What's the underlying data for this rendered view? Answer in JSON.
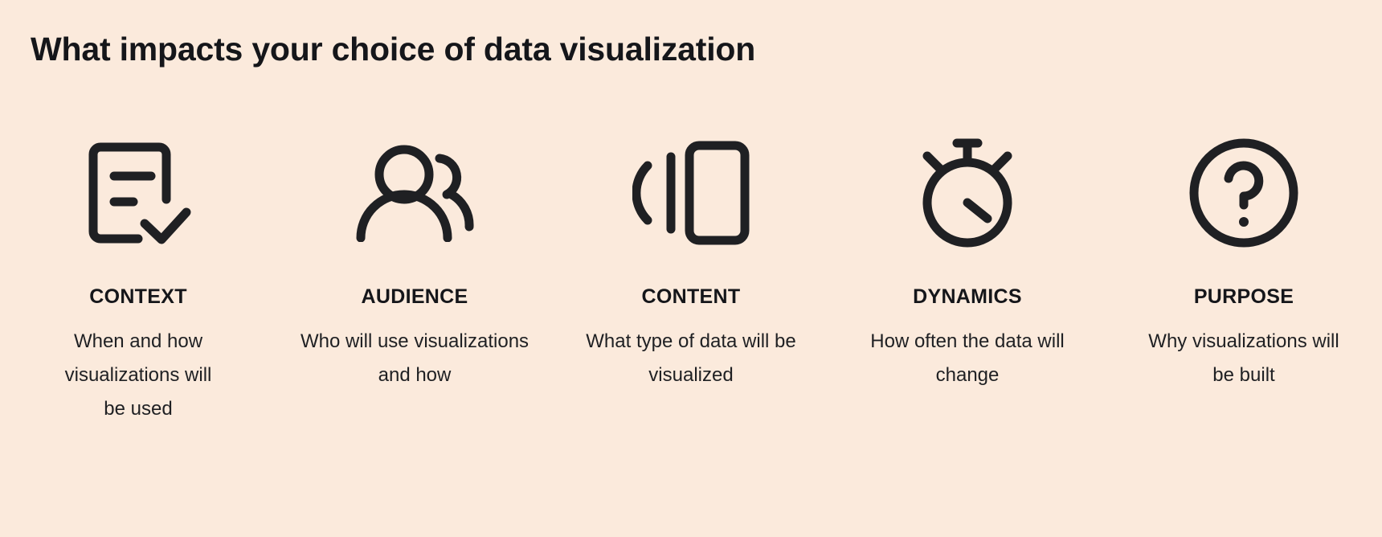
{
  "page": {
    "title": "What impacts your choice of data visualization",
    "background_color": "#fbeadc",
    "text_color": "#1f2023",
    "icon_color": "#1f2023"
  },
  "columns": [
    {
      "icon": "document-check-icon",
      "label": "CONTEXT",
      "text": "When and how visualizations will be used"
    },
    {
      "icon": "users-icon",
      "label": "AUDIENCE",
      "text": "Who will use visualizations and how"
    },
    {
      "icon": "card-stack-icon",
      "label": "CONTENT",
      "text": "What type of data will be visualized"
    },
    {
      "icon": "stopwatch-icon",
      "label": "DYNAMICS",
      "text": "How often the data will change"
    },
    {
      "icon": "question-circle-icon",
      "label": "PURPOSE",
      "text": "Why visualizations will be built"
    }
  ]
}
